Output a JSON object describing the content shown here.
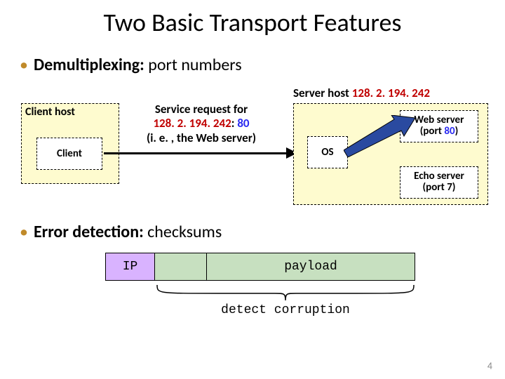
{
  "title": "Two Basic Transport Features",
  "bullet1": {
    "lead": "Demultiplexing:",
    "tail": " port numbers"
  },
  "server_title": {
    "prefix": "Server host ",
    "ip": "128. 2. 194. 242"
  },
  "client_host_label": "Client host",
  "client_inner": "Client",
  "svc": {
    "l1": "Service request for",
    "ip": "128. 2. 194. 242",
    "colon": ": ",
    "port": "80",
    "l3": "(i. e. , the Web server)"
  },
  "os_label": "OS",
  "web": {
    "name": "Web server",
    "port_open": "(port ",
    "port": "80",
    "port_close": ")"
  },
  "echo": {
    "name": "Echo server",
    "port": "(port 7)"
  },
  "bullet2": {
    "lead": "Error detection:",
    "tail": " checksums"
  },
  "pkt": {
    "ip": "IP",
    "payload": "payload"
  },
  "detect": "detect corruption",
  "pagenum": "4"
}
